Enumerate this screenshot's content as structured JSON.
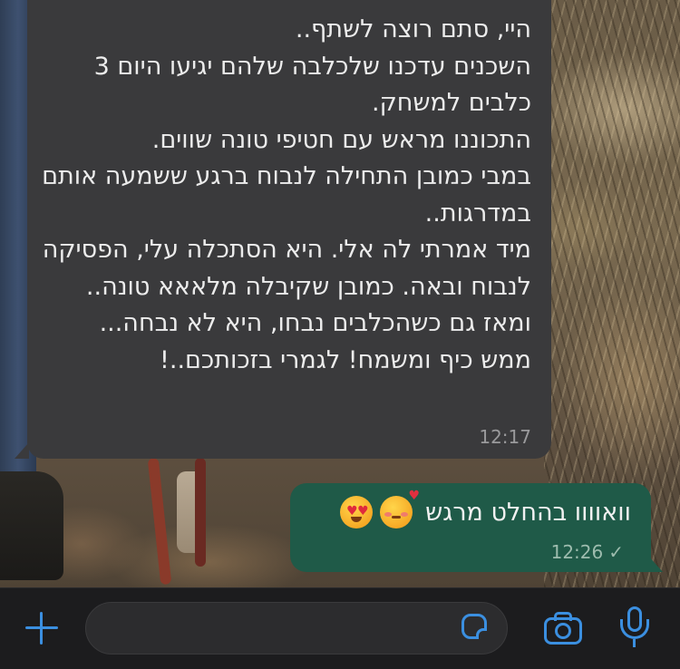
{
  "chat": {
    "incoming": {
      "text": "היי, סתם רוצה לשתף..\nהשכנים עדכנו שלכלבה שלהם יגיעו היום 3 כלבים למשחק.\nהתכוננו מראש עם חטיפי טונה שווים.\nבמבי כמובן התחילה לנבוח ברגע ששמעה אותם במדרגות..\nמיד אמרתי לה אלי. היא הסתכלה עלי, הפסיקה לנבוח ובאה. כמובן שקיבלה מלאאא טונה.. ומאז גם כשהכלבים נבחו, היא לא נבחה...\nממש כיף ומשמח! לגמרי בזכותכם..!",
      "time": "12:17"
    },
    "outgoing": {
      "text": "וואוווו בהחלט מרגש",
      "emojis": [
        "smiling-face-with-hearts",
        "heart-eyes"
      ],
      "time": "12:26",
      "status_icon": "check-icon"
    }
  },
  "composer": {
    "placeholder": "",
    "accent_color": "#3b8fe0",
    "icons": [
      "plus-icon",
      "sticker-icon",
      "camera-icon",
      "microphone-icon"
    ]
  },
  "colors": {
    "incoming_bubble": "#3a3a3c",
    "outgoing_bubble": "#1f5a48",
    "input_bar": "#1c1c1e"
  }
}
